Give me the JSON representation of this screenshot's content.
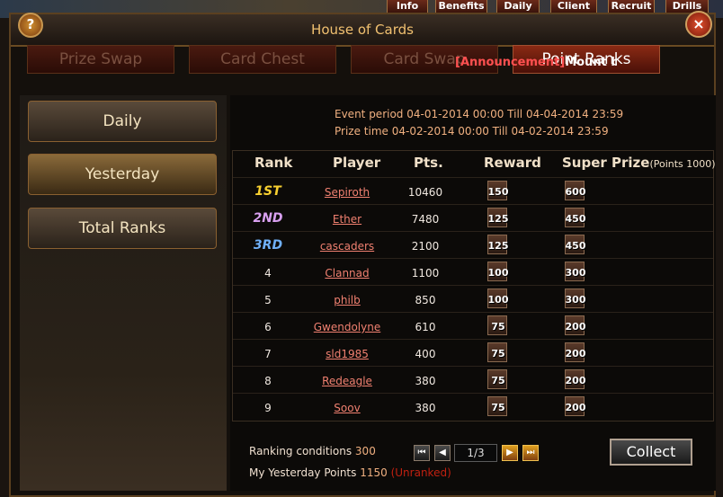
{
  "top_buttons": [
    "Info",
    "Benefits",
    "Daily",
    "Client",
    "Recruit",
    "Drills"
  ],
  "window": {
    "title": "House of Cards"
  },
  "tabs": [
    {
      "label": "Prize Swap",
      "active": false
    },
    {
      "label": "Card Chest",
      "active": false
    },
    {
      "label": "Card Swap",
      "active": false
    },
    {
      "label": "Point Ranks",
      "active": true
    }
  ],
  "announcement": {
    "tag": "[Announcement]",
    "message": "Mount bo"
  },
  "left_menu": [
    {
      "label": "Daily",
      "active": false
    },
    {
      "label": "Yesterday",
      "active": true
    },
    {
      "label": "Total Ranks",
      "active": false
    }
  ],
  "event": {
    "period": "Event period 04-01-2014 00:00 Till 04-04-2014 23:59",
    "prize_time": "Prize time 04-02-2014 00:00 Till 04-02-2014 23:59"
  },
  "table": {
    "headers": {
      "rank": "Rank",
      "player": "Player",
      "pts": "Pts.",
      "reward": "Reward",
      "super_prize": "Super Prize",
      "super_prize_note": "(Points 1000)"
    },
    "rows": [
      {
        "rank": "1ST",
        "player": "Sepiroth",
        "pts": "10460",
        "reward": "150",
        "super": "600"
      },
      {
        "rank": "2ND",
        "player": "Ether",
        "pts": "7480",
        "reward": "125",
        "super": "450"
      },
      {
        "rank": "3RD",
        "player": "cascaders",
        "pts": "2100",
        "reward": "125",
        "super": "450"
      },
      {
        "rank": "4",
        "player": "Clannad",
        "pts": "1100",
        "reward": "100",
        "super": "300"
      },
      {
        "rank": "5",
        "player": "philb",
        "pts": "850",
        "reward": "100",
        "super": "300"
      },
      {
        "rank": "6",
        "player": "Gwendolyne",
        "pts": "610",
        "reward": "75",
        "super": "200"
      },
      {
        "rank": "7",
        "player": "sld1985",
        "pts": "400",
        "reward": "75",
        "super": "200"
      },
      {
        "rank": "8",
        "player": "Redeagle",
        "pts": "380",
        "reward": "75",
        "super": "200"
      },
      {
        "rank": "9",
        "player": "Soov",
        "pts": "380",
        "reward": "75",
        "super": "200"
      }
    ]
  },
  "footer": {
    "ranking_label": "Ranking conditions",
    "ranking_value": "300",
    "points_label": "My Yesterday Points",
    "points_value": "1150",
    "status": "(Unranked)"
  },
  "pagination": {
    "page": "1/3"
  },
  "collect_label": "Collect",
  "colors": {
    "rank1": "#f8d030",
    "rank2": "#d8a0f0",
    "rank3": "#70b0f8",
    "accent": "#f0c070"
  }
}
